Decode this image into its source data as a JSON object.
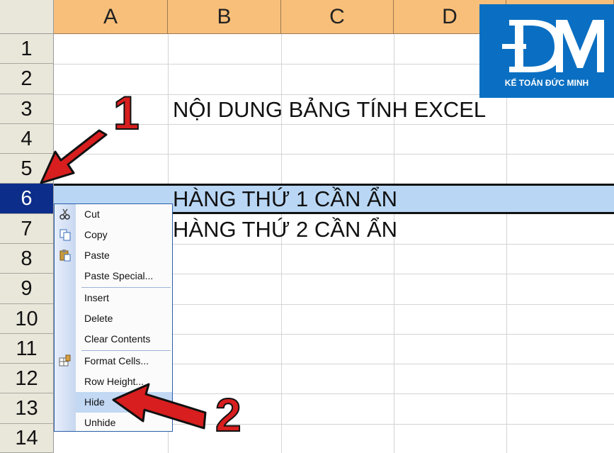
{
  "sheet": {
    "columns": [
      "A",
      "B",
      "C",
      "D"
    ],
    "rows": [
      "1",
      "2",
      "3",
      "4",
      "5",
      "6",
      "7",
      "8",
      "9",
      "10",
      "11",
      "12",
      "13",
      "14"
    ],
    "selected_row": "6",
    "cells": {
      "b3": "NỘI DUNG BẢNG TÍNH EXCEL",
      "b6": "HÀNG THỨ 1 CẦN ẨN",
      "b7": "HÀNG THỨ 2 CẦN ẨN"
    }
  },
  "logo": {
    "tagline": "KẾ TOÁN ĐỨC MINH",
    "bg_color": "#0a6fc2"
  },
  "context_menu": {
    "items": [
      {
        "label": "Cut",
        "icon": "scissors-icon"
      },
      {
        "label": "Copy",
        "icon": "copy-icon"
      },
      {
        "label": "Paste",
        "icon": "clipboard-icon"
      },
      {
        "label": "Paste Special...",
        "icon": ""
      },
      {
        "label": "Insert",
        "icon": ""
      },
      {
        "label": "Delete",
        "icon": ""
      },
      {
        "label": "Clear Contents",
        "icon": ""
      },
      {
        "label": "Format Cells...",
        "icon": "format-cells-icon"
      },
      {
        "label": "Row Height...",
        "icon": ""
      },
      {
        "label": "Hide",
        "icon": ""
      },
      {
        "label": "Unhide",
        "icon": ""
      }
    ],
    "highlighted": "Hide"
  },
  "annotations": {
    "step1": "1",
    "step2": "2",
    "arrow_color": "#d81e1e"
  }
}
